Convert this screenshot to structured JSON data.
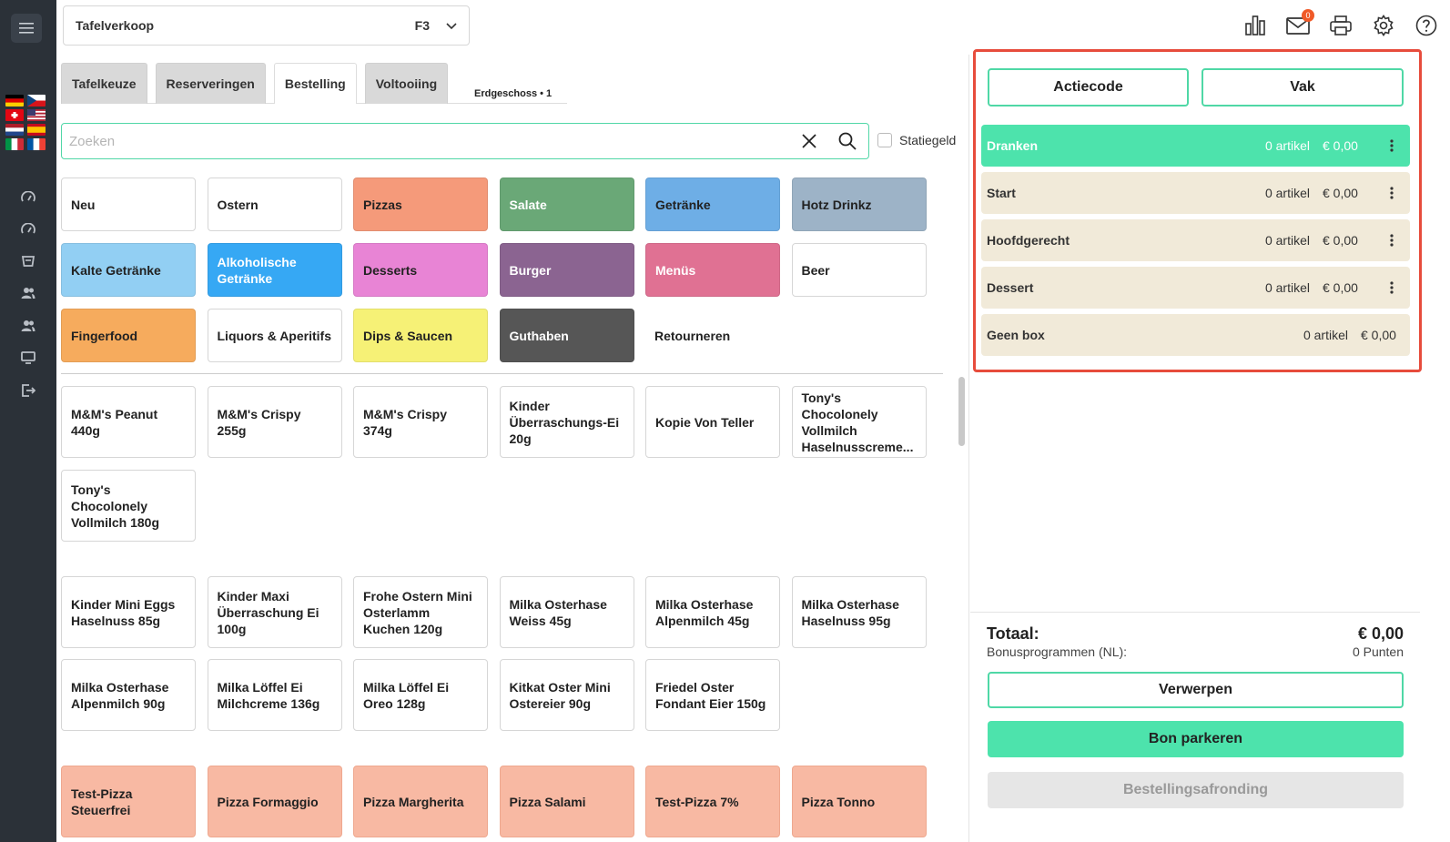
{
  "header": {
    "select_name": "Tafelverkoop",
    "select_key": "F3",
    "mail_badge": "0"
  },
  "tabs": [
    {
      "label": "Tafelkeuze"
    },
    {
      "label": "Reserveringen"
    },
    {
      "label": "Bestelling"
    },
    {
      "label": "Voltooiing"
    }
  ],
  "location": "Erdgeschoss • 1",
  "search": {
    "placeholder": "Zoeken",
    "value": ""
  },
  "deposit_label": "Statiegeld",
  "categories": [
    {
      "label": "Neu",
      "bg": "#ffffff",
      "fg": "#222222"
    },
    {
      "label": "Ostern",
      "bg": "#ffffff",
      "fg": "#222222"
    },
    {
      "label": "Pizzas",
      "bg": "#f59a7a",
      "fg": "#222222"
    },
    {
      "label": "Salate",
      "bg": "#6aa877",
      "fg": "#ffffff"
    },
    {
      "label": "Getränke",
      "bg": "#6eaee6",
      "fg": "#222222"
    },
    {
      "label": "Hotz Drinkz",
      "bg": "#9db3c7",
      "fg": "#222222"
    },
    {
      "label": "Kalte Getränke",
      "bg": "#92cff3",
      "fg": "#222222"
    },
    {
      "label": "Alkoholische Getränke",
      "bg": "#36a8f4",
      "fg": "#ffffff"
    },
    {
      "label": "Desserts",
      "bg": "#e884d5",
      "fg": "#222222"
    },
    {
      "label": "Burger",
      "bg": "#8b6491",
      "fg": "#ffffff"
    },
    {
      "label": "Menüs",
      "bg": "#e07193",
      "fg": "#ffffff"
    },
    {
      "label": "Beer",
      "bg": "#ffffff",
      "fg": "#222222"
    },
    {
      "label": "Fingerfood",
      "bg": "#f6ab5d",
      "fg": "#222222"
    },
    {
      "label": "Liquors & Aperitifs",
      "bg": "#ffffff",
      "fg": "#222222"
    },
    {
      "label": "Dips & Saucen",
      "bg": "#f6f176",
      "fg": "#222222"
    },
    {
      "label": "Guthaben",
      "bg": "#565656",
      "fg": "#ffffff"
    },
    {
      "label": "Retourneren",
      "bg": "transparent",
      "fg": "#222222"
    }
  ],
  "products": [
    {
      "label": "M&M's Peanut 440g"
    },
    {
      "label": "M&M's Crispy 255g"
    },
    {
      "label": "M&M's Crispy 374g"
    },
    {
      "label": "Kinder Überraschungs-Ei 20g"
    },
    {
      "label": "Kopie Von Teller"
    },
    {
      "label": "Tony's Chocolonely Vollmilch Haselnusscreme..."
    },
    {
      "label": "Tony's Chocolonely Vollmilch 180g"
    },
    {
      "label": "Kinder Mini Eggs Haselnuss 85g"
    },
    {
      "label": "Kinder Maxi Überraschung Ei 100g"
    },
    {
      "label": "Frohe Ostern Mini Osterlamm Kuchen 120g"
    },
    {
      "label": "Milka Osterhase Weiss 45g"
    },
    {
      "label": "Milka Osterhase Alpenmilch 45g"
    },
    {
      "label": "Milka Osterhase Haselnuss 95g"
    },
    {
      "label": "Milka Osterhase Alpenmilch 90g"
    },
    {
      "label": "Milka Löffel Ei Milchcreme 136g"
    },
    {
      "label": "Milka Löffel Ei Oreo 128g"
    },
    {
      "label": "Kitkat Oster Mini Ostereier 90g"
    },
    {
      "label": "Friedel Oster Fondant Eier 150g"
    },
    {
      "label": "Test-Pizza Steuerfrei"
    },
    {
      "label": "Pizza Formaggio"
    },
    {
      "label": "Pizza Margherita"
    },
    {
      "label": "Pizza Salami"
    },
    {
      "label": "Test-Pizza 7%"
    },
    {
      "label": "Pizza Tonno"
    }
  ],
  "right": {
    "actiecode": "Actiecode",
    "vak": "Vak",
    "groups": [
      {
        "name": "Dranken",
        "count": "0 artikel",
        "price": "€ 0,00"
      },
      {
        "name": "Start",
        "count": "0 artikel",
        "price": "€ 0,00"
      },
      {
        "name": "Hoofdgerecht",
        "count": "0 artikel",
        "price": "€ 0,00"
      },
      {
        "name": "Dessert",
        "count": "0 artikel",
        "price": "€ 0,00"
      },
      {
        "name": "Geen box",
        "count": "0 artikel",
        "price": "€ 0,00"
      }
    ],
    "total_label": "Totaal:",
    "total_value": "€ 0,00",
    "bonus_label": "Bonusprogrammen (NL):",
    "bonus_value": "0 Punten",
    "discard": "Verwerpen",
    "park": "Bon parkeren",
    "finish": "Bestellingsafronding"
  },
  "colors": {
    "accent": "#4de3ac",
    "highlight": "#e74c3c",
    "group_bg": "#f1ead9"
  }
}
